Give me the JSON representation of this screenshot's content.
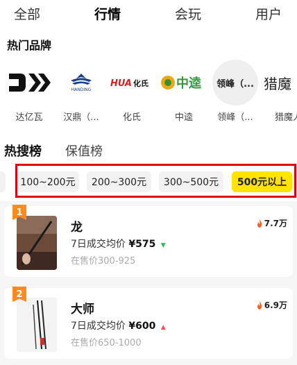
{
  "top_nav": {
    "tabs": [
      {
        "label": "全部",
        "active": false
      },
      {
        "label": "行情",
        "active": true
      },
      {
        "label": "会玩",
        "active": false
      },
      {
        "label": "用户",
        "active": false
      }
    ]
  },
  "brands": {
    "title": "热门品牌",
    "items": [
      {
        "name": "达亿瓦",
        "logo": "DAIWA"
      },
      {
        "name": "汉鼎（...",
        "logo": "HANDING"
      },
      {
        "name": "化氏",
        "logo": "HUA 化氏"
      },
      {
        "name": "中逵",
        "logo": "中逵"
      },
      {
        "name": "领峰（...",
        "logo": "领峰（..."
      },
      {
        "name": "猎魔人",
        "logo": "猎魔"
      }
    ]
  },
  "ranking": {
    "tabs": [
      {
        "label": "热搜榜",
        "active": true
      },
      {
        "label": "保值榜",
        "active": false
      }
    ],
    "price_chips": [
      {
        "label": "100~200元",
        "active": false
      },
      {
        "label": "200~300元",
        "active": false
      },
      {
        "label": "300~500元",
        "active": false
      },
      {
        "label": "500元以上",
        "active": true
      }
    ],
    "items": [
      {
        "rank": "1",
        "title": "龙",
        "avg_label": "7日成交均价",
        "price": "¥575",
        "trend": "▼",
        "trend_color": "#2dbb5d",
        "on_sale": "在售价300-925",
        "heat": "7.7万"
      },
      {
        "rank": "2",
        "title": "大师",
        "avg_label": "7日成交均价",
        "price": "¥600",
        "trend": "▲",
        "trend_color": "#ff4d4f",
        "on_sale": "在售价650-1000",
        "heat": "6.9万"
      }
    ]
  },
  "colors": {
    "accent": "#ffe400",
    "highlight": "#e00012",
    "rank_badge": "#ff8a1f",
    "heat_icon": "#ff5a1f"
  }
}
